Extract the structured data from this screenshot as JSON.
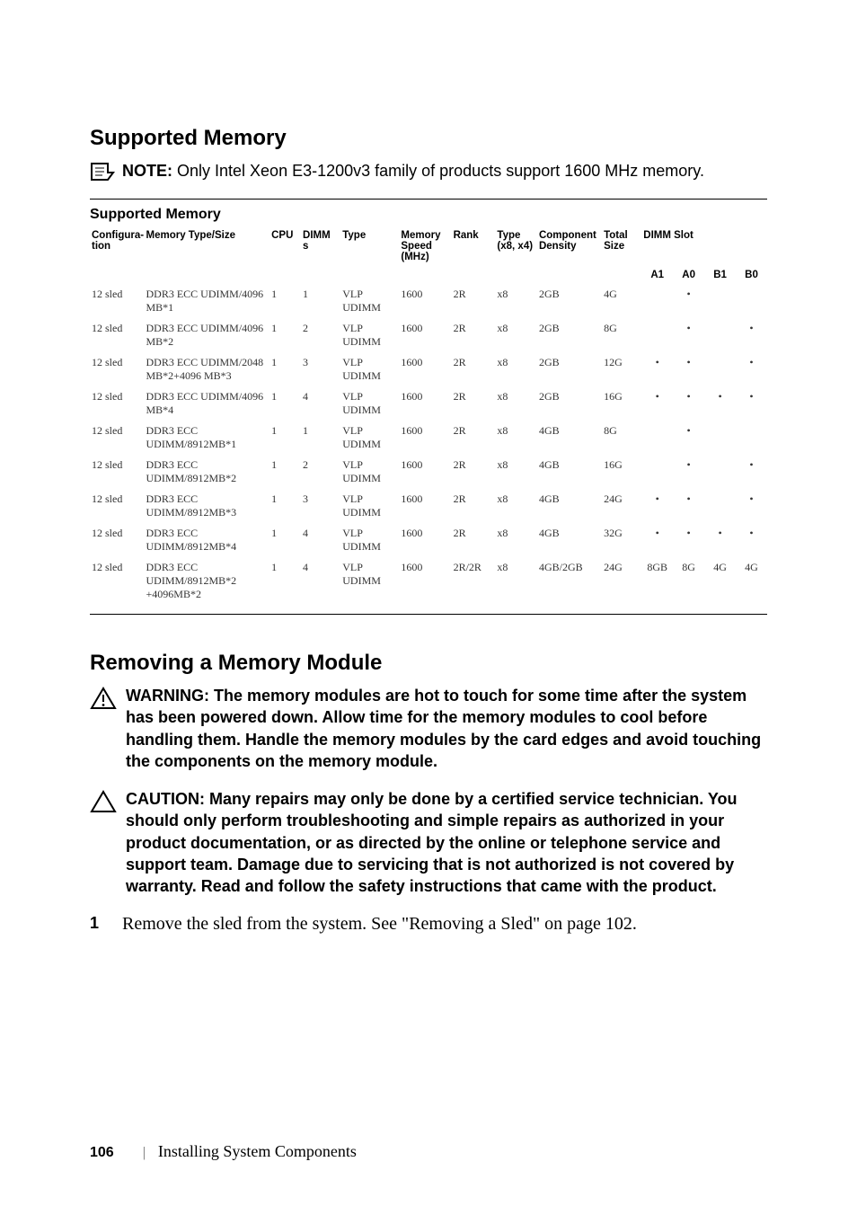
{
  "section1_title": "Supported Memory",
  "note_lead": "NOTE:",
  "note_text": " Only Intel Xeon E3-1200v3 family of products support 1600 MHz memory.",
  "table_title": "Supported Memory",
  "headers": {
    "config": "Configura-",
    "config2": "tion",
    "memtypesize": "Memory Type/Size",
    "cpu": "CPU",
    "dimms": "DIMM",
    "dimms2": "s",
    "type": "Type",
    "memspeed": "Memory",
    "memspeed2": "Speed",
    "memspeed3": "(MHz)",
    "rank": "Rank",
    "typex": "Type",
    "typex2": "(x8, x4)",
    "compdens": "Component",
    "compdens2": "Density",
    "totalsize": "Total",
    "totalsize2": "Size",
    "dimmslot": "DIMM Slot",
    "a1": "A1",
    "a0": "A0",
    "b1": "B1",
    "b0": "B0"
  },
  "rows": [
    {
      "config": "12 sled",
      "mts": "DDR3 ECC UDIMM/4096 MB*1",
      "cpu": "1",
      "dimms": "1",
      "type": "VLP UDIMM",
      "speed": "1600",
      "rank": "2R",
      "xt": "x8",
      "dens": "2GB",
      "tot": "4G",
      "a1": "",
      "a0": "•",
      "b1": "",
      "b0": ""
    },
    {
      "config": "12 sled",
      "mts": "DDR3 ECC UDIMM/4096 MB*2",
      "cpu": "1",
      "dimms": "2",
      "type": "VLP UDIMM",
      "speed": "1600",
      "rank": "2R",
      "xt": "x8",
      "dens": "2GB",
      "tot": "8G",
      "a1": "",
      "a0": "•",
      "b1": "",
      "b0": "•"
    },
    {
      "config": "12 sled",
      "mts": "DDR3 ECC UDIMM/2048 MB*2+4096 MB*3",
      "cpu": "1",
      "dimms": "3",
      "type": "VLP UDIMM",
      "speed": "1600",
      "rank": "2R",
      "xt": "x8",
      "dens": "2GB",
      "tot": "12G",
      "a1": "•",
      "a0": "•",
      "b1": "",
      "b0": "•"
    },
    {
      "config": "12 sled",
      "mts": "DDR3 ECC UDIMM/4096 MB*4",
      "cpu": "1",
      "dimms": "4",
      "type": "VLP UDIMM",
      "speed": "1600",
      "rank": "2R",
      "xt": "x8",
      "dens": "2GB",
      "tot": "16G",
      "a1": "•",
      "a0": "•",
      "b1": "•",
      "b0": "•"
    },
    {
      "config": "12 sled",
      "mts": "DDR3 ECC UDIMM/8912MB*1",
      "cpu": "1",
      "dimms": "1",
      "type": "VLP UDIMM",
      "speed": "1600",
      "rank": "2R",
      "xt": "x8",
      "dens": "4GB",
      "tot": "8G",
      "a1": "",
      "a0": "•",
      "b1": "",
      "b0": ""
    },
    {
      "config": "12 sled",
      "mts": "DDR3 ECC UDIMM/8912MB*2",
      "cpu": "1",
      "dimms": "2",
      "type": "VLP UDIMM",
      "speed": "1600",
      "rank": "2R",
      "xt": "x8",
      "dens": "4GB",
      "tot": "16G",
      "a1": "",
      "a0": "•",
      "b1": "",
      "b0": "•"
    },
    {
      "config": "12 sled",
      "mts": "DDR3 ECC UDIMM/8912MB*3",
      "cpu": "1",
      "dimms": "3",
      "type": "VLP UDIMM",
      "speed": "1600",
      "rank": "2R",
      "xt": "x8",
      "dens": "4GB",
      "tot": "24G",
      "a1": "•",
      "a0": "•",
      "b1": "",
      "b0": "•"
    },
    {
      "config": "12 sled",
      "mts": "DDR3 ECC UDIMM/8912MB*4",
      "cpu": "1",
      "dimms": "4",
      "type": "VLP UDIMM",
      "speed": "1600",
      "rank": "2R",
      "xt": "x8",
      "dens": "4GB",
      "tot": "32G",
      "a1": "•",
      "a0": "•",
      "b1": "•",
      "b0": "•"
    },
    {
      "config": "12 sled",
      "mts": "DDR3 ECC UDIMM/8912MB*2 +4096MB*2",
      "cpu": "1",
      "dimms": "4",
      "type": "VLP UDIMM",
      "speed": "1600",
      "rank": "2R/2R",
      "xt": "x8",
      "dens": "4GB/2GB",
      "tot": "24G",
      "a1": "8GB",
      "a0": "8G",
      "b1": "4G",
      "b0": "4G"
    }
  ],
  "section2_title": "Removing a Memory Module",
  "warning_lead": "WARNING: ",
  "warning_text": "The memory modules are hot to touch for some time after the system has been powered down. Allow time for the memory modules to cool before handling them. Handle the memory modules by the card edges and avoid touching the components on the memory module.",
  "caution_lead": "CAUTION: ",
  "caution_text": "Many repairs may only be done by a certified service technician. You should only perform troubleshooting and simple repairs as authorized in your product documentation, or as directed by the online or telephone service and support team. Damage due to servicing that is not authorized is not covered by warranty. Read and follow the safety instructions that came with the product.",
  "step1_num": "1",
  "step1_text": "Remove the sled from the system. See \"Removing a Sled\" on page 102.",
  "footer_page": "106",
  "footer_chapter": "Installing System Components"
}
